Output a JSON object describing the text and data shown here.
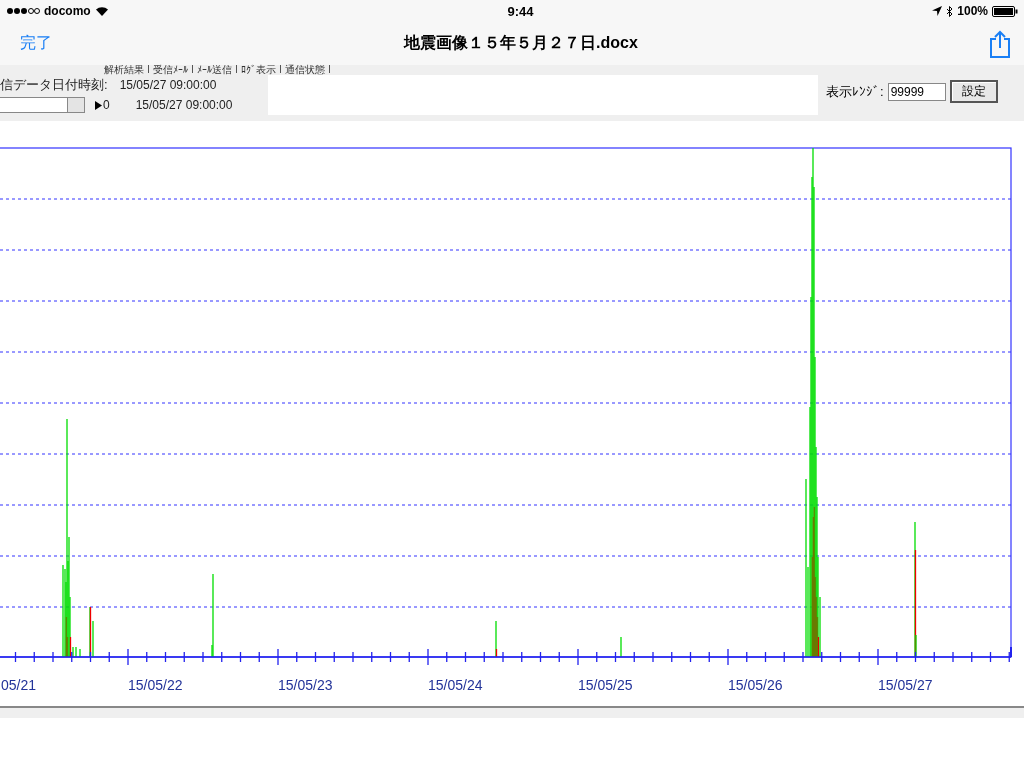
{
  "status_bar": {
    "carrier": "docomo",
    "time": "9:44",
    "battery": "100%"
  },
  "nav_bar": {
    "done": "完了",
    "title": "地震画像１５年５月２７日.docx"
  },
  "app": {
    "tabs": [
      "解析結果",
      "受信ﾒｰﾙ",
      "ﾒｰﾙ送信",
      "ﾛｸﾞ表示",
      "通信状態"
    ],
    "received_label": "信データ日付時刻:",
    "received_time": "15/05/27 09:00:00",
    "slider_value": "0",
    "slider_time": "15/05/27 09:00:00",
    "range_label": "表示ﾚﾝｼﾞ:",
    "range_value": "99999",
    "set_button": "設定"
  },
  "chart": {
    "x_labels": [
      "05/21",
      "15/05/22",
      "15/05/23",
      "15/05/24",
      "15/05/25",
      "15/05/26",
      "15/05/27"
    ]
  }
}
